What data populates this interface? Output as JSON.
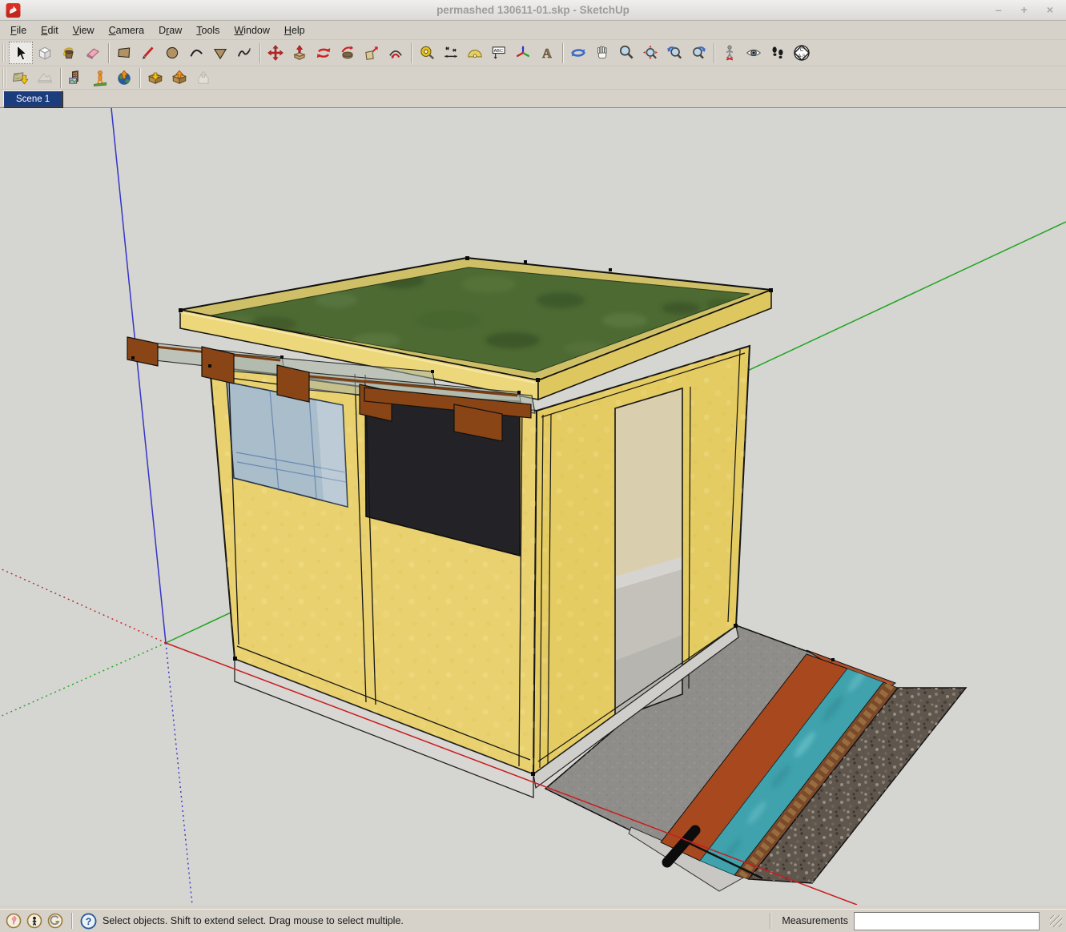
{
  "window": {
    "title": "permashed 130611-01.skp - SketchUp",
    "controls": {
      "minimize": "–",
      "maximize": "+",
      "close": "×"
    }
  },
  "menu": {
    "items": [
      {
        "label": "File",
        "underline": 0
      },
      {
        "label": "Edit",
        "underline": 0
      },
      {
        "label": "View",
        "underline": 0
      },
      {
        "label": "Camera",
        "underline": 0
      },
      {
        "label": "Draw",
        "underline": 1
      },
      {
        "label": "Tools",
        "underline": 0
      },
      {
        "label": "Window",
        "underline": 0
      },
      {
        "label": "Help",
        "underline": 0
      }
    ]
  },
  "toolbar_main": {
    "active_tool": "select",
    "buttons": [
      "select",
      "make-component",
      "paint-bucket",
      "eraser",
      "rectangle",
      "line",
      "circle",
      "arc",
      "polygon",
      "freehand",
      "move",
      "push-pull",
      "rotate",
      "follow-me",
      "scale",
      "offset",
      "tape-measure",
      "dimension",
      "protractor",
      "text",
      "axes",
      "3d-text",
      "orbit",
      "pan",
      "zoom",
      "zoom-extents",
      "zoom-previous",
      "zoom-next",
      "position-camera",
      "look-around",
      "walk",
      "section-plane"
    ]
  },
  "toolbar_google": {
    "buttons": [
      "add-location",
      "toggle-terrain",
      "photo-textures",
      "street-view-pegman",
      "preview-in-google-earth",
      "get-models",
      "share-model",
      "share-component"
    ],
    "disabled": [
      "toggle-terrain",
      "share-component"
    ]
  },
  "scene_tabs": [
    {
      "label": "Scene 1",
      "active": true
    }
  ],
  "viewport": {
    "background": "#d5d5d2"
  },
  "axes": {
    "red": "#c81e1e",
    "green": "#1ea51e",
    "blue": "#3535c8"
  },
  "model": {
    "description": "small shed with green living roof, straw-yellow panel walls, glass awnings, open doorway, concrete apron and water channel with gravel bank",
    "colors": {
      "straw": "#e9d16f",
      "straw_dark": "#e4cb62",
      "roof_grass": "#4d6a33",
      "roof_rim": "#cfc068",
      "fascia": "#ecd77b",
      "fascia_right": "#dfc75f",
      "glass_window": "#a9bdca",
      "panel_black": "#232327",
      "awning_glass": "#aab4a4",
      "bracket_brown": "#8a4516",
      "interior": "#d9cfae",
      "interior_floor": "#c4c1bb",
      "foundation": "#d8d7d3",
      "concrete": "#8f8d8a",
      "channel_rust": "#b0502a",
      "channel_rust_dark": "#a8481f",
      "water": "#3fa2ac",
      "brick": "#7a4a2a",
      "gravel": "#5f564d",
      "pipe_black": "#0c0c0c"
    }
  },
  "status": {
    "icons": [
      "attribution-icon",
      "model-credit-icon",
      "geolocation-icon",
      "help-icon"
    ],
    "message": "Select objects. Shift to extend select. Drag mouse to select multiple.",
    "measurements_label": "Measurements",
    "measurements_value": ""
  }
}
